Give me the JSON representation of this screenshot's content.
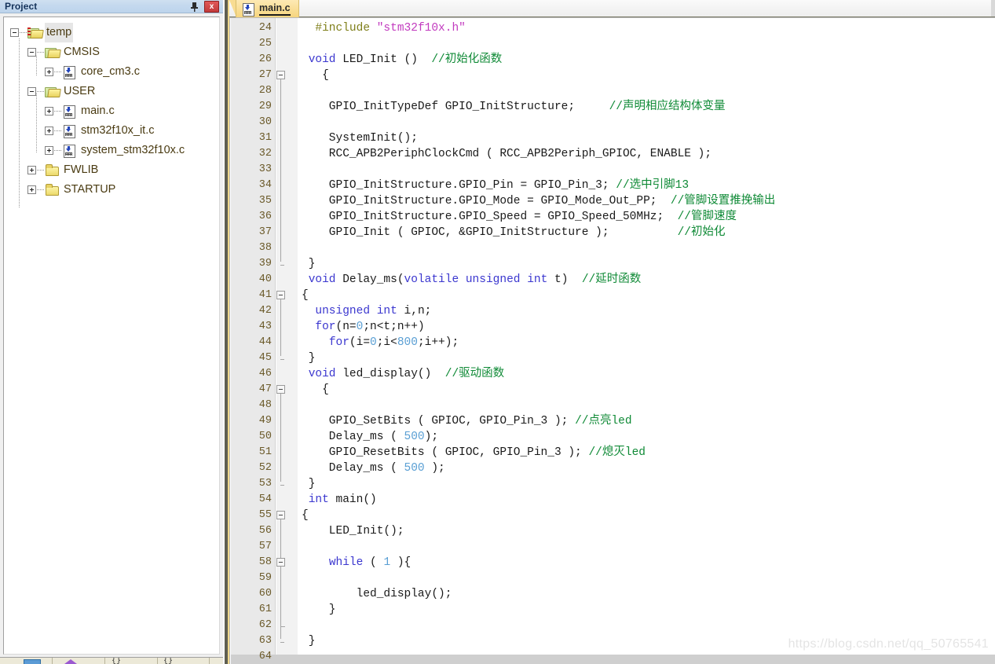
{
  "project_pane": {
    "title": "Project",
    "pin_icon": "pin-icon",
    "close_label": "x",
    "tree": [
      {
        "label": "temp",
        "depth": 0,
        "expander": "minus",
        "icon": "folder-open-marked-icon",
        "selected": true
      },
      {
        "label": "CMSIS",
        "depth": 1,
        "expander": "minus",
        "icon": "folder-open-icon",
        "selected": false
      },
      {
        "label": "core_cm3.c",
        "depth": 2,
        "expander": "plus",
        "icon": "c-file-icon",
        "selected": false
      },
      {
        "label": "USER",
        "depth": 1,
        "expander": "minus",
        "icon": "folder-open-icon",
        "selected": false
      },
      {
        "label": "main.c",
        "depth": 2,
        "expander": "plus",
        "icon": "c-file-icon",
        "selected": false
      },
      {
        "label": "stm32f10x_it.c",
        "depth": 2,
        "expander": "plus",
        "icon": "c-file-icon",
        "selected": false
      },
      {
        "label": "system_stm32f10x.c",
        "depth": 2,
        "expander": "plus",
        "icon": "c-file-icon",
        "selected": false
      },
      {
        "label": "FWLIB",
        "depth": 1,
        "expander": "plus",
        "icon": "folder-icon",
        "selected": false
      },
      {
        "label": "STARTUP",
        "depth": 1,
        "expander": "plus",
        "icon": "folder-icon",
        "selected": false
      }
    ]
  },
  "bottom_toolbar": {
    "brace_1": "{}",
    "brace_2": "{}"
  },
  "editor": {
    "tabs": [
      {
        "label": "main.c",
        "icon": "c-file-icon",
        "active": true
      }
    ],
    "first_line": 24,
    "lines": [
      {
        "n": 24,
        "tokens": [
          {
            "t": "  ",
            "c": ""
          },
          {
            "t": "#include ",
            "c": "pp"
          },
          {
            "t": "\"stm32f10x.h\"",
            "c": "st"
          }
        ],
        "fold": ""
      },
      {
        "n": 25,
        "tokens": [],
        "fold": ""
      },
      {
        "n": 26,
        "tokens": [
          {
            "t": " ",
            "c": ""
          },
          {
            "t": "void",
            "c": "k"
          },
          {
            "t": " LED_Init ()  ",
            "c": ""
          },
          {
            "t": "//初始化函数",
            "c": "cm"
          }
        ],
        "fold": ""
      },
      {
        "n": 27,
        "tokens": [
          {
            "t": "   {",
            "c": ""
          }
        ],
        "fold": "start"
      },
      {
        "n": 28,
        "tokens": [],
        "fold": "bar"
      },
      {
        "n": 29,
        "tokens": [
          {
            "t": "    GPIO_InitTypeDef GPIO_InitStructure;     ",
            "c": ""
          },
          {
            "t": "//声明相应结构体变量",
            "c": "cm"
          }
        ],
        "fold": "bar"
      },
      {
        "n": 30,
        "tokens": [],
        "fold": "bar"
      },
      {
        "n": 31,
        "tokens": [
          {
            "t": "    SystemInit();",
            "c": ""
          }
        ],
        "fold": "bar"
      },
      {
        "n": 32,
        "tokens": [
          {
            "t": "    RCC_APB2PeriphClockCmd ( RCC_APB2Periph_GPIOC, ENABLE );",
            "c": ""
          }
        ],
        "fold": "bar"
      },
      {
        "n": 33,
        "tokens": [],
        "fold": "bar"
      },
      {
        "n": 34,
        "tokens": [
          {
            "t": "    GPIO_InitStructure.GPIO_Pin = GPIO_Pin_3; ",
            "c": ""
          },
          {
            "t": "//选中引脚13",
            "c": "cm"
          }
        ],
        "fold": "bar"
      },
      {
        "n": 35,
        "tokens": [
          {
            "t": "    GPIO_InitStructure.GPIO_Mode = GPIO_Mode_Out_PP;  ",
            "c": ""
          },
          {
            "t": "//管脚设置推挽输出",
            "c": "cm"
          }
        ],
        "fold": "bar"
      },
      {
        "n": 36,
        "tokens": [
          {
            "t": "    GPIO_InitStructure.GPIO_Speed = GPIO_Speed_50MHz;  ",
            "c": ""
          },
          {
            "t": "//管脚速度",
            "c": "cm"
          }
        ],
        "fold": "bar"
      },
      {
        "n": 37,
        "tokens": [
          {
            "t": "    GPIO_Init ( GPIOC, &GPIO_InitStructure );          ",
            "c": ""
          },
          {
            "t": "//初始化",
            "c": "cm"
          }
        ],
        "fold": "bar"
      },
      {
        "n": 38,
        "tokens": [],
        "fold": "bar"
      },
      {
        "n": 39,
        "tokens": [
          {
            "t": " }",
            "c": ""
          }
        ],
        "fold": "end"
      },
      {
        "n": 40,
        "tokens": [
          {
            "t": " ",
            "c": ""
          },
          {
            "t": "void",
            "c": "k"
          },
          {
            "t": " Delay_ms(",
            "c": ""
          },
          {
            "t": "volatile",
            "c": "k"
          },
          {
            "t": " ",
            "c": ""
          },
          {
            "t": "unsigned",
            "c": "k"
          },
          {
            "t": " ",
            "c": ""
          },
          {
            "t": "int",
            "c": "k"
          },
          {
            "t": " t)  ",
            "c": ""
          },
          {
            "t": "//延时函数",
            "c": "cm"
          }
        ],
        "fold": ""
      },
      {
        "n": 41,
        "tokens": [
          {
            "t": "{",
            "c": ""
          }
        ],
        "fold": "start"
      },
      {
        "n": 42,
        "tokens": [
          {
            "t": "  ",
            "c": ""
          },
          {
            "t": "unsigned",
            "c": "k"
          },
          {
            "t": " ",
            "c": ""
          },
          {
            "t": "int",
            "c": "k"
          },
          {
            "t": " i,n;",
            "c": ""
          }
        ],
        "fold": "bar"
      },
      {
        "n": 43,
        "tokens": [
          {
            "t": "  ",
            "c": ""
          },
          {
            "t": "for",
            "c": "k"
          },
          {
            "t": "(n=",
            "c": ""
          },
          {
            "t": "0",
            "c": "nu"
          },
          {
            "t": ";n<t;n++)",
            "c": ""
          }
        ],
        "fold": "bar"
      },
      {
        "n": 44,
        "tokens": [
          {
            "t": "    ",
            "c": ""
          },
          {
            "t": "for",
            "c": "k"
          },
          {
            "t": "(i=",
            "c": ""
          },
          {
            "t": "0",
            "c": "nu"
          },
          {
            "t": ";i<",
            "c": ""
          },
          {
            "t": "800",
            "c": "nu"
          },
          {
            "t": ";i++);",
            "c": ""
          }
        ],
        "fold": "bar"
      },
      {
        "n": 45,
        "tokens": [
          {
            "t": " }",
            "c": ""
          }
        ],
        "fold": "end"
      },
      {
        "n": 46,
        "tokens": [
          {
            "t": " ",
            "c": ""
          },
          {
            "t": "void",
            "c": "k"
          },
          {
            "t": " led_display()  ",
            "c": ""
          },
          {
            "t": "//驱动函数",
            "c": "cm"
          }
        ],
        "fold": ""
      },
      {
        "n": 47,
        "tokens": [
          {
            "t": "   {",
            "c": ""
          }
        ],
        "fold": "start"
      },
      {
        "n": 48,
        "tokens": [],
        "fold": "bar"
      },
      {
        "n": 49,
        "tokens": [
          {
            "t": "    GPIO_SetBits ( GPIOC, GPIO_Pin_3 ); ",
            "c": ""
          },
          {
            "t": "//点亮led",
            "c": "cm"
          }
        ],
        "fold": "bar"
      },
      {
        "n": 50,
        "tokens": [
          {
            "t": "    Delay_ms ( ",
            "c": ""
          },
          {
            "t": "500",
            "c": "nu"
          },
          {
            "t": ");",
            "c": ""
          }
        ],
        "fold": "bar"
      },
      {
        "n": 51,
        "tokens": [
          {
            "t": "    GPIO_ResetBits ( GPIOC, GPIO_Pin_3 ); ",
            "c": ""
          },
          {
            "t": "//熄灭led",
            "c": "cm"
          }
        ],
        "fold": "bar"
      },
      {
        "n": 52,
        "tokens": [
          {
            "t": "    Delay_ms ( ",
            "c": ""
          },
          {
            "t": "500",
            "c": "nu"
          },
          {
            "t": " );",
            "c": ""
          }
        ],
        "fold": "bar"
      },
      {
        "n": 53,
        "tokens": [
          {
            "t": " }",
            "c": ""
          }
        ],
        "fold": "end"
      },
      {
        "n": 54,
        "tokens": [
          {
            "t": " ",
            "c": ""
          },
          {
            "t": "int",
            "c": "k"
          },
          {
            "t": " main()",
            "c": ""
          }
        ],
        "fold": ""
      },
      {
        "n": 55,
        "tokens": [
          {
            "t": "{",
            "c": ""
          }
        ],
        "fold": "start"
      },
      {
        "n": 56,
        "tokens": [
          {
            "t": "    LED_Init();",
            "c": ""
          }
        ],
        "fold": "bar"
      },
      {
        "n": 57,
        "tokens": [],
        "fold": "bar"
      },
      {
        "n": 58,
        "tokens": [
          {
            "t": "    ",
            "c": ""
          },
          {
            "t": "while",
            "c": "k"
          },
          {
            "t": " ( ",
            "c": ""
          },
          {
            "t": "1",
            "c": "nu"
          },
          {
            "t": " ){",
            "c": ""
          }
        ],
        "fold": "start2"
      },
      {
        "n": 59,
        "tokens": [],
        "fold": "bar"
      },
      {
        "n": 60,
        "tokens": [
          {
            "t": "        led_display();",
            "c": ""
          }
        ],
        "fold": "bar"
      },
      {
        "n": 61,
        "tokens": [
          {
            "t": "    }",
            "c": ""
          }
        ],
        "fold": "bar"
      },
      {
        "n": 62,
        "tokens": [],
        "fold": "tick"
      },
      {
        "n": 63,
        "tokens": [
          {
            "t": " }",
            "c": ""
          }
        ],
        "fold": "bar"
      },
      {
        "n": 64,
        "tokens": [],
        "fold": "bar"
      }
    ]
  },
  "watermark": {
    "text": "https://blog.csdn.net/qq_50765541"
  },
  "colors": {
    "keyword": "#3b37cf",
    "comment": "#0f8a36",
    "preprocessor": "#7f7f1a",
    "string": "#c23bbf",
    "number": "#5a9fd4",
    "tree_text": "#4a3b12",
    "tab_bg": "#f8dc92",
    "title_bg": "#c3d8ee"
  }
}
